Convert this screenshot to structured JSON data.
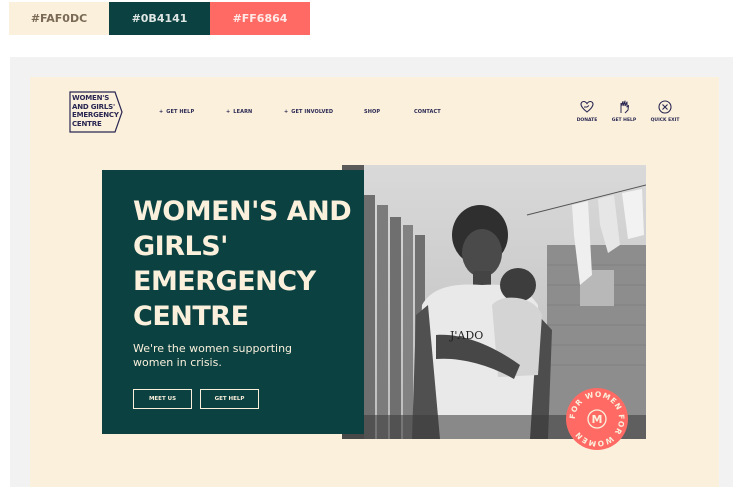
{
  "swatches": [
    {
      "label": "#FAF0DC",
      "color": "#FAF0DC"
    },
    {
      "label": "#0B4141",
      "color": "#0B4141"
    },
    {
      "label": "#FF6864",
      "color": "#FF6B64"
    }
  ],
  "logo": {
    "lines": [
      "WOMEN'S",
      "AND GIRLS'",
      "EMERGENCY",
      "CENTRE"
    ]
  },
  "nav": {
    "items": [
      {
        "label": "GET HELP",
        "plus": "+"
      },
      {
        "label": "LEARN",
        "plus": "+"
      },
      {
        "label": "GET INVOLVED",
        "plus": "+"
      },
      {
        "label": "SHOP",
        "plus": ""
      },
      {
        "label": "CONTACT",
        "plus": ""
      }
    ]
  },
  "utility": {
    "donate": "DONATE",
    "get_help": "GET HELP",
    "quick_exit": "QUICK EXIT"
  },
  "hero": {
    "title_lines": [
      "WOMEN'S AND",
      "GIRLS'",
      "EMERGENCY",
      "CENTRE"
    ],
    "subtitle_lines": [
      "We're the women supporting",
      "women in crisis."
    ],
    "meet_button": "MEET US",
    "help_button": "GET HELP"
  },
  "badge": {
    "text": "FOR WOMEN FOR WOMEN",
    "letter": "M"
  },
  "colors": {
    "cream": "#FAF0DC",
    "teal": "#0B4141",
    "coral": "#FF6B64",
    "navy": "#2a2752"
  }
}
